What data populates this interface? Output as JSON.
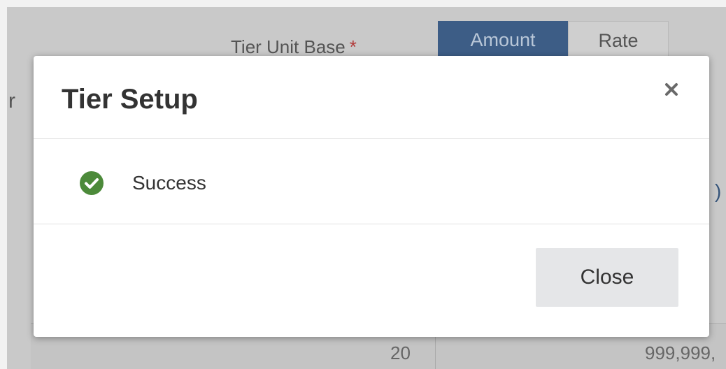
{
  "background": {
    "tier_unit_base_label": "Tier Unit Base",
    "required_mark": "*",
    "toggle": {
      "amount_label": "Amount",
      "rate_label": "Rate",
      "selected": "Amount"
    },
    "left_fragment": "r",
    "right_fragment": ")",
    "table_row": {
      "cell_a": "20",
      "cell_b": "999,999,"
    }
  },
  "modal": {
    "title": "Tier Setup",
    "close_x": "×",
    "message": "Success",
    "close_button_label": "Close",
    "success_color": "#4c8a3a"
  }
}
